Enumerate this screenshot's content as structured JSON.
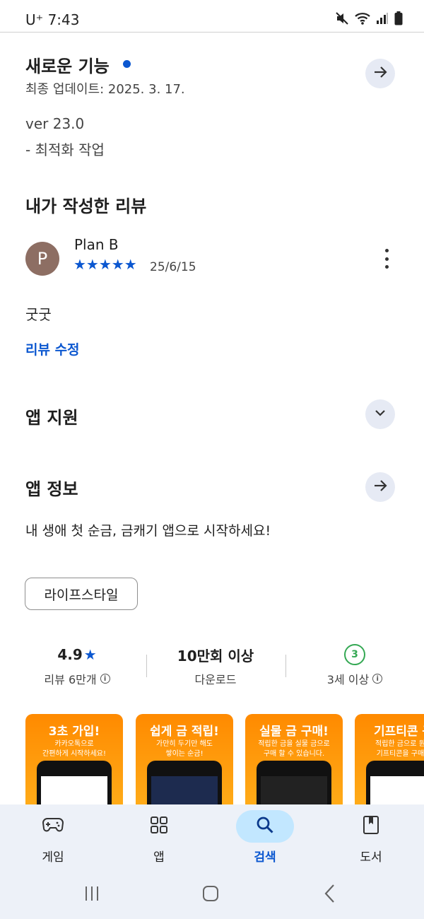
{
  "status_bar": {
    "time": "7:43",
    "carrier": "U⁺"
  },
  "whats_new": {
    "title": "새로운 기능",
    "updated": "최종 업데이트: 2025. 3. 17.",
    "version": "ver 23.0",
    "note": "- 최적화 작업"
  },
  "my_review": {
    "title": "내가 작성한 리뷰",
    "avatar_letter": "P",
    "reviewer": "Plan B",
    "rating": 5,
    "stars": "★★★★★",
    "date": "25/6/15",
    "text": "굿굿",
    "edit_label": "리뷰 수정"
  },
  "app_support": {
    "title": "앱 지원"
  },
  "app_info": {
    "title": "앱 정보",
    "description": "내 생애 첫 순금, 금캐기 앱으로 시작하세요!",
    "category": "라이프스타일"
  },
  "stats": {
    "rating": "4.9",
    "rating_star": "★",
    "reviews": "리뷰 6만개",
    "downloads": "10만회 이상",
    "downloads_label": "다운로드",
    "age_badge": "3",
    "age_label": "3세 이상",
    "info_glyph": "i"
  },
  "screenshots": [
    {
      "headline": "3초 가입!",
      "sub1": "카카오톡으로",
      "sub2": "간편하게 시작하세요!"
    },
    {
      "headline": "쉽게 금 적립!",
      "sub1": "가만히 두기만 해도",
      "sub2": "쌓이는 순금!"
    },
    {
      "headline": "실물 금 구매!",
      "sub1": "적립한 금을 실물 금으로",
      "sub2": "구매 할 수 있습니다."
    },
    {
      "headline": "기프티콘 구",
      "sub1": "적립한 금으로 원하",
      "sub2": "기프티콘을 구매하"
    }
  ],
  "bottom_nav": {
    "items": [
      {
        "label": "게임",
        "icon": "gamepad-icon"
      },
      {
        "label": "앱",
        "icon": "apps-grid-icon"
      },
      {
        "label": "검색",
        "icon": "search-icon",
        "active": true
      },
      {
        "label": "도서",
        "icon": "book-icon"
      }
    ]
  },
  "colors": {
    "accent": "#0b57d0",
    "nav_bg": "#edf1f8",
    "active_pill": "#c2e7ff",
    "badge_green": "#34a853"
  }
}
